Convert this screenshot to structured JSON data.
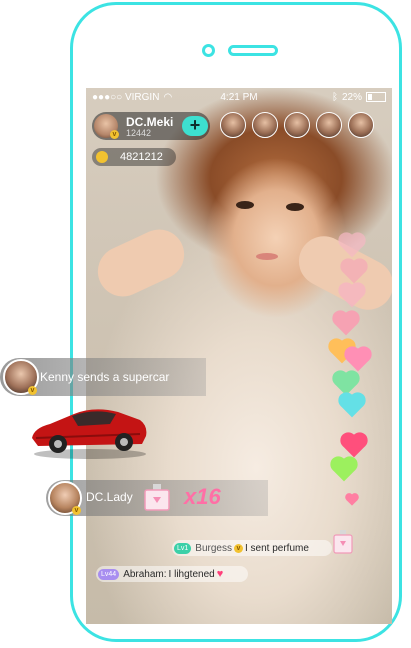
{
  "status_bar": {
    "carrier": "●●●○○ VIRGIN",
    "time": "4:21 PM",
    "battery": "22%"
  },
  "host": {
    "name": "DC.Meki",
    "id": "12442",
    "follow_label": "+"
  },
  "coins": {
    "count": "4821212"
  },
  "gift_events": [
    {
      "text": "Kenny sends a supercar"
    }
  ],
  "combo_gift": {
    "sender": "DC.Lady",
    "count": "x16"
  },
  "chat": [
    {
      "level": "Lv1",
      "name": "Burgess",
      "message": "I sent perfume"
    },
    {
      "level": "Lv44",
      "name": "Abraham:",
      "message": "I lihgtened"
    }
  ],
  "colors": {
    "frame": "#3ce3e3",
    "follow_button": "#3de0d0",
    "combo": "#ff6fa6",
    "level1": "#3cd0a8",
    "level44": "#a88ef0"
  }
}
